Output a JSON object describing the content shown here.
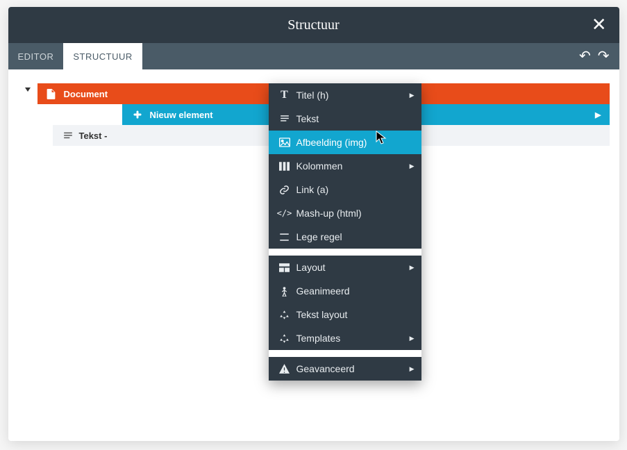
{
  "titlebar": {
    "title": "Structuur"
  },
  "tabs": {
    "editor": "EDITOR",
    "structuur": "STRUCTUUR"
  },
  "tree": {
    "document": "Document",
    "nieuw_element": "Nieuw element",
    "tekst": "Tekst -"
  },
  "menu": {
    "section1": [
      {
        "id": "titel",
        "label": "Titel (h)",
        "submenu": true
      },
      {
        "id": "tekst",
        "label": "Tekst",
        "submenu": false
      },
      {
        "id": "afbeelding",
        "label": "Afbeelding (img)",
        "submenu": false,
        "hover": true
      },
      {
        "id": "kolommen",
        "label": "Kolommen",
        "submenu": true
      },
      {
        "id": "link",
        "label": "Link (a)",
        "submenu": false
      },
      {
        "id": "mashup",
        "label": "Mash-up (html)",
        "submenu": false
      },
      {
        "id": "lege",
        "label": "Lege regel",
        "submenu": false
      }
    ],
    "section2": [
      {
        "id": "layout",
        "label": "Layout",
        "submenu": true
      },
      {
        "id": "geanimeerd",
        "label": "Geanimeerd",
        "submenu": false
      },
      {
        "id": "tekstlayout",
        "label": "Tekst layout",
        "submenu": false
      },
      {
        "id": "templates",
        "label": "Templates",
        "submenu": true
      }
    ],
    "section3": [
      {
        "id": "geavanceerd",
        "label": "Geavanceerd",
        "submenu": true
      }
    ]
  }
}
